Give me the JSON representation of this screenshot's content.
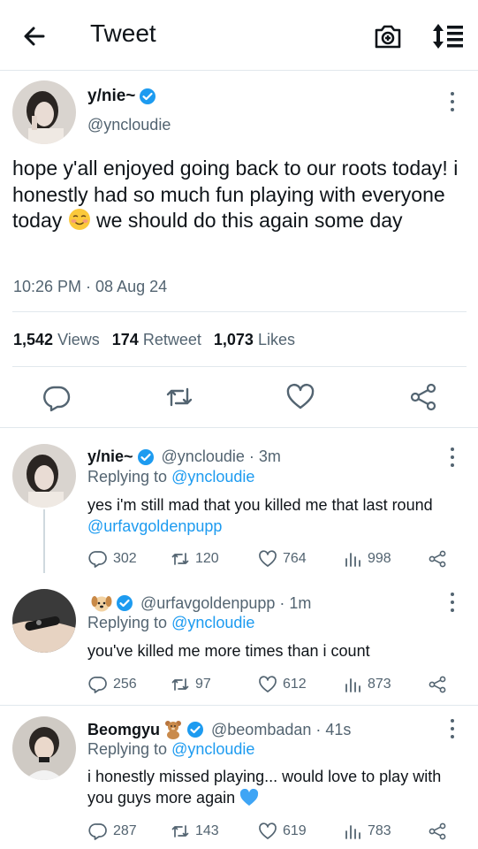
{
  "header": {
    "title": "Tweet"
  },
  "main_tweet": {
    "name": "y/nie~",
    "handle": "@yncloudie",
    "text_before_emoji": "hope y'all enjoyed going back to our roots today! i honestly had so much fun playing with everyone today",
    "text_after_emoji": " we should do this again some day",
    "time": "10:26 PM · 08 Aug 24",
    "stats": {
      "views_count": "1,542",
      "views_label": "Views",
      "retweets_count": "174",
      "retweets_label": "Retweet",
      "likes_count": "1,073",
      "likes_label": "Likes"
    }
  },
  "replies": [
    {
      "name": "y/nie~",
      "handle_time": "@yncloudie · 3m",
      "replying_prefix": "Replying to",
      "replying_to": "@yncloudie",
      "text": "yes i'm still mad that you killed me that last round",
      "mention": "@urfavgoldenpupp",
      "comments": "302",
      "retweets": "120",
      "likes": "764",
      "views": "998"
    },
    {
      "name": "",
      "handle_time": "@urfavgoldenpupp · 1m",
      "replying_prefix": "Replying to",
      "replying_to": "@yncloudie",
      "text": "you've killed me more times than i count",
      "comments": "256",
      "retweets": "97",
      "likes": "612",
      "views": "873"
    },
    {
      "name": "Beomgyu",
      "handle_time": "@beombadan · 41s",
      "replying_prefix": "Replying to",
      "replying_to": "@yncloudie",
      "text": "i honestly missed playing... would love to play with you guys more again",
      "comments": "287",
      "retweets": "143",
      "likes": "619",
      "views": "783"
    }
  ],
  "colors": {
    "accent": "#1d9bf0",
    "muted": "#536471",
    "border": "#e1e8ed"
  },
  "icons": [
    "back-arrow-icon",
    "camera-plus-icon",
    "sort-icon",
    "verified-icon",
    "more-icon",
    "reply-icon",
    "retweet-icon",
    "like-icon",
    "share-icon",
    "views-icon",
    "puppy-emoji-icon",
    "teddy-bear-emoji-icon",
    "blush-emoji-icon",
    "blue-heart-emoji-icon"
  ]
}
